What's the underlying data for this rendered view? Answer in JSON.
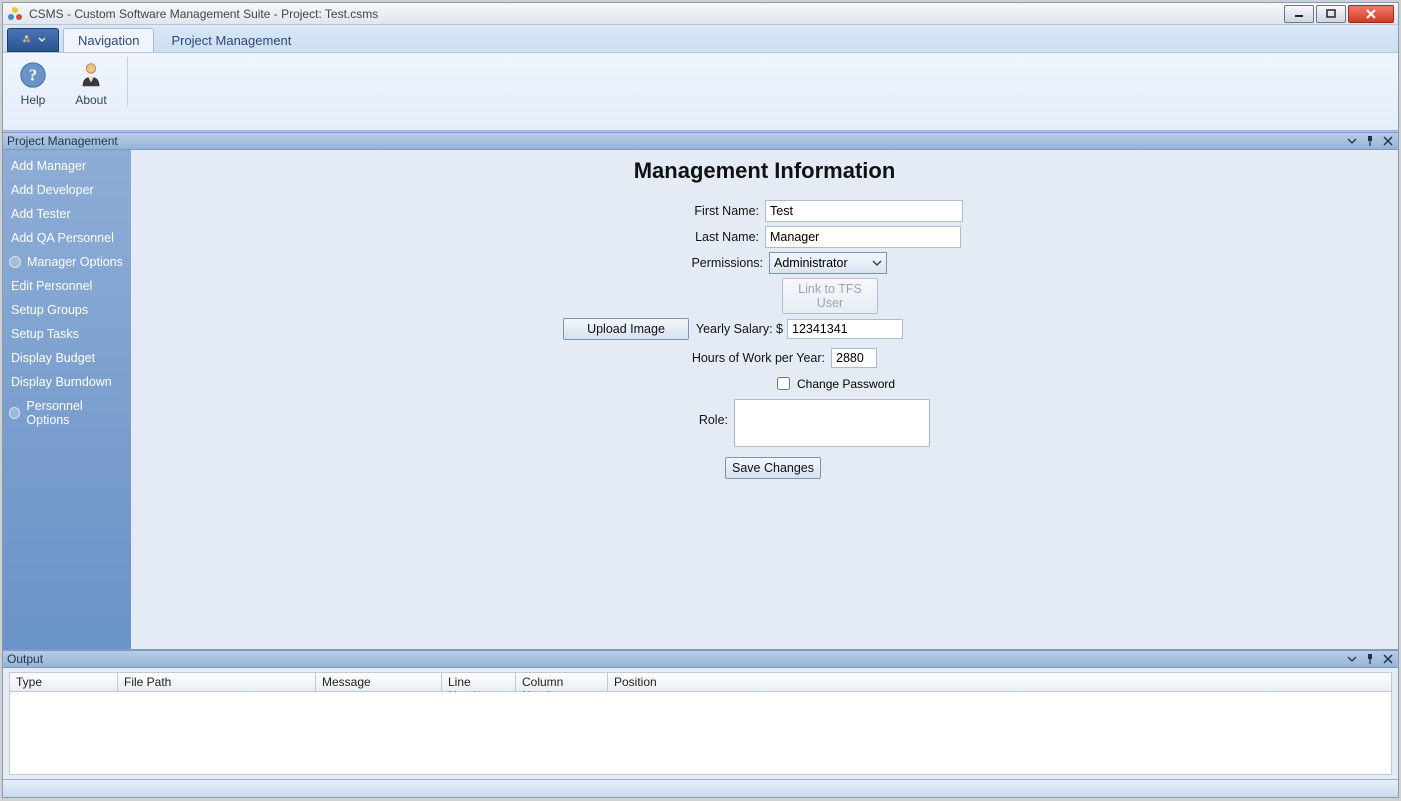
{
  "window": {
    "title": "CSMS - Custom Software Management Suite - Project: Test.csms"
  },
  "ribbon": {
    "tabs": {
      "navigation": "Navigation",
      "project_management": "Project Management"
    },
    "buttons": {
      "help": "Help",
      "about": "About"
    }
  },
  "panels": {
    "project_management_title": "Project Management",
    "output_title": "Output"
  },
  "sidebar": {
    "add_manager": "Add Manager",
    "add_developer": "Add Developer",
    "add_tester": "Add Tester",
    "add_qa": "Add QA Personnel",
    "manager_options": "Manager Options",
    "edit_personnel": "Edit Personnel",
    "setup_groups": "Setup Groups",
    "setup_tasks": "Setup Tasks",
    "display_budget": "Display Budget",
    "display_burndown": "Display Burndown",
    "personnel_options": "Personnel Options"
  },
  "form": {
    "title": "Management Information",
    "labels": {
      "first_name": "First Name:",
      "last_name": "Last Name:",
      "permissions": "Permissions:",
      "link_tfs": "Link to TFS User",
      "upload_image": "Upload Image",
      "yearly_salary": "Yearly Salary: $",
      "hours_per_year": "Hours of Work per Year:",
      "change_password": "Change Password",
      "role": "Role:",
      "save_changes": "Save Changes"
    },
    "values": {
      "first_name": "Test",
      "last_name": "Manager",
      "permissions": "Administrator",
      "yearly_salary": "12341341",
      "hours_per_year": "2880",
      "role": ""
    }
  },
  "output": {
    "columns": {
      "type": "Type",
      "file_path": "File Path",
      "message": "Message",
      "line": "Line Number",
      "column": "Column Number",
      "position": "Position"
    }
  }
}
